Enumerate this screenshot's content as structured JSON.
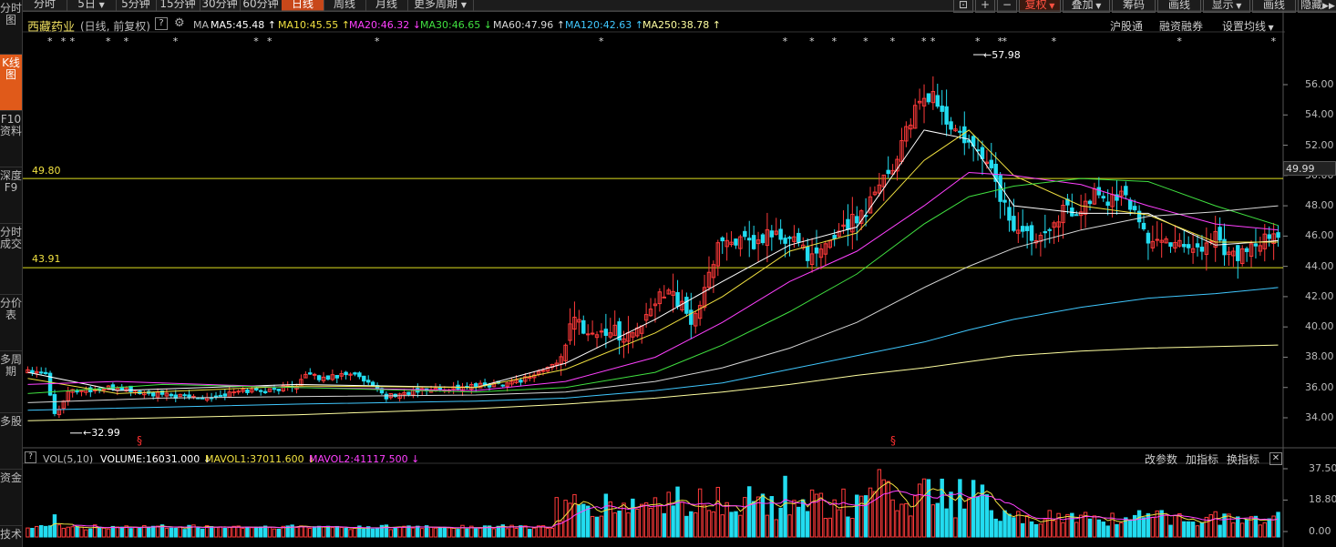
{
  "sidebar": [
    "分时图",
    "K线图",
    "F10资料",
    "深度F9",
    "分时成交",
    "分价表",
    "多周期",
    "多股",
    "资金",
    "技术"
  ],
  "toolbar": {
    "periods": [
      "分时",
      "5日",
      "5分钟",
      "15分钟",
      "30分钟",
      "60分钟",
      "日线",
      "周线",
      "月线",
      "更多周期"
    ],
    "right": [
      "复权",
      "叠加",
      "筹码",
      "画线",
      "显示",
      "画线",
      "隐藏"
    ]
  },
  "header": {
    "stock_name": "西藏药业",
    "mode": "(日线, 前复权)",
    "links": [
      "沪股通",
      "融资融券",
      "设置均线"
    ]
  },
  "ma": {
    "label": "MA",
    "lines": [
      {
        "text": "MA5:45.48 ↑",
        "color": "#ffffff"
      },
      {
        "text": "MA10:45.55 ↑",
        "color": "#f0e040"
      },
      {
        "text": "MA20:46.32 ↓",
        "color": "#ff40ff"
      },
      {
        "text": "MA30:46.65 ↓",
        "color": "#40e040"
      },
      {
        "text": "MA60:47.96 ↑",
        "color": "#d8d8d8"
      },
      {
        "text": "MA120:42.63 ↑",
        "color": "#40c8ff"
      },
      {
        "text": "MA250:38.78 ↑",
        "color": "#ffffa0"
      }
    ]
  },
  "chart_data": {
    "type": "candlestick",
    "y_ticks": [
      "56.00",
      "54.00",
      "52.00",
      "50.00",
      "48.00",
      "46.00",
      "44.00",
      "42.00",
      "40.00",
      "38.00",
      "36.00",
      "34.00"
    ],
    "ylim": [
      33,
      58.5
    ],
    "last_price": 49.99,
    "last_price_label": "49.99",
    "hlines": [
      {
        "value": 49.8,
        "label": "49.80",
        "color": "#e0e020"
      },
      {
        "value": 43.91,
        "label": "43.91",
        "color": "#e0e020"
      }
    ],
    "annotations": {
      "high": "←57.98",
      "low": "←32.99"
    },
    "colors": {
      "up": "#ff3a3a",
      "down": "#22dcf0"
    },
    "waypoints": [
      [
        0,
        37.2
      ],
      [
        4,
        37.0
      ],
      [
        6,
        34.2
      ],
      [
        9,
        35.8
      ],
      [
        14,
        35.8
      ],
      [
        20,
        36.0
      ],
      [
        26,
        35.6
      ],
      [
        34,
        35.4
      ],
      [
        42,
        35.4
      ],
      [
        48,
        35.8
      ],
      [
        54,
        35.8
      ],
      [
        60,
        36.2
      ],
      [
        62,
        36.8
      ],
      [
        66,
        36.6
      ],
      [
        72,
        37.0
      ],
      [
        76,
        36.2
      ],
      [
        80,
        35.4
      ],
      [
        88,
        35.8
      ],
      [
        96,
        36.0
      ],
      [
        104,
        36.2
      ],
      [
        110,
        36.5
      ],
      [
        114,
        37.0
      ],
      [
        118,
        37.6
      ],
      [
        122,
        40.5
      ],
      [
        126,
        39.5
      ],
      [
        130,
        39.8
      ],
      [
        134,
        39.4
      ],
      [
        138,
        40.4
      ],
      [
        140,
        41.6
      ],
      [
        143,
        42.8
      ],
      [
        146,
        41.2
      ],
      [
        148,
        40.4
      ],
      [
        151,
        42.2
      ],
      [
        154,
        45.6
      ],
      [
        158,
        45.8
      ],
      [
        162,
        45.2
      ],
      [
        166,
        46.3
      ],
      [
        169,
        45.5
      ],
      [
        172,
        45.8
      ],
      [
        175,
        44.4
      ],
      [
        178,
        45.2
      ],
      [
        181,
        46.5
      ],
      [
        184,
        47.0
      ],
      [
        187,
        47.8
      ],
      [
        190,
        49.8
      ],
      [
        193,
        50.4
      ],
      [
        196,
        53.2
      ],
      [
        199,
        54.6
      ],
      [
        202,
        55.4
      ],
      [
        205,
        53.4
      ],
      [
        208,
        52.6
      ],
      [
        211,
        51.6
      ],
      [
        214,
        51.2
      ],
      [
        217,
        48.6
      ],
      [
        220,
        46.6
      ],
      [
        223,
        46.0
      ],
      [
        226,
        46.2
      ],
      [
        229,
        47.2
      ],
      [
        232,
        47.8
      ],
      [
        235,
        47.6
      ],
      [
        238,
        48.8
      ],
      [
        241,
        48.4
      ],
      [
        244,
        48.6
      ],
      [
        247,
        47.8
      ],
      [
        250,
        45.8
      ],
      [
        253,
        45.5
      ],
      [
        256,
        45.8
      ],
      [
        259,
        45.4
      ],
      [
        262,
        45.2
      ],
      [
        265,
        46.2
      ],
      [
        268,
        44.8
      ],
      [
        271,
        44.8
      ],
      [
        274,
        45.2
      ],
      [
        277,
        45.9
      ],
      [
        279,
        45.8
      ]
    ],
    "ma_colors": [
      "#ffffff",
      "#f0e040",
      "#ff40ff",
      "#40e040",
      "#d8d8d8",
      "#40c8ff",
      "#ffffa0"
    ],
    "ma_lines": [
      [
        [
          0,
          37.0
        ],
        [
          20,
          35.8
        ],
        [
          60,
          36.2
        ],
        [
          100,
          36.0
        ],
        [
          120,
          37.6
        ],
        [
          140,
          40.5
        ],
        [
          155,
          43.0
        ],
        [
          170,
          45.4
        ],
        [
          185,
          46.6
        ],
        [
          200,
          53.0
        ],
        [
          210,
          52.4
        ],
        [
          220,
          48.0
        ],
        [
          235,
          47.5
        ],
        [
          250,
          47.5
        ],
        [
          265,
          45.4
        ],
        [
          279,
          45.7
        ]
      ],
      [
        [
          0,
          36.6
        ],
        [
          20,
          35.6
        ],
        [
          60,
          36.1
        ],
        [
          100,
          36.0
        ],
        [
          120,
          37.2
        ],
        [
          140,
          39.6
        ],
        [
          155,
          42.0
        ],
        [
          170,
          45.0
        ],
        [
          185,
          46.2
        ],
        [
          200,
          51.0
        ],
        [
          210,
          53.0
        ],
        [
          220,
          50.0
        ],
        [
          235,
          48.0
        ],
        [
          250,
          47.4
        ],
        [
          265,
          45.6
        ],
        [
          279,
          45.6
        ]
      ],
      [
        [
          0,
          36.2
        ],
        [
          20,
          36.4
        ],
        [
          60,
          36.0
        ],
        [
          100,
          35.8
        ],
        [
          120,
          36.4
        ],
        [
          140,
          38.0
        ],
        [
          155,
          40.3
        ],
        [
          170,
          43.0
        ],
        [
          185,
          45.0
        ],
        [
          200,
          48.0
        ],
        [
          210,
          50.2
        ],
        [
          220,
          50.0
        ],
        [
          235,
          49.4
        ],
        [
          250,
          48.0
        ],
        [
          265,
          46.8
        ],
        [
          279,
          46.4
        ]
      ],
      [
        [
          0,
          35.6
        ],
        [
          30,
          36.2
        ],
        [
          60,
          36.0
        ],
        [
          100,
          35.7
        ],
        [
          120,
          36.0
        ],
        [
          140,
          37.0
        ],
        [
          155,
          38.8
        ],
        [
          170,
          41.0
        ],
        [
          185,
          43.5
        ],
        [
          200,
          46.8
        ],
        [
          210,
          48.6
        ],
        [
          220,
          49.3
        ],
        [
          235,
          49.8
        ],
        [
          250,
          49.6
        ],
        [
          265,
          48.0
        ],
        [
          279,
          46.7
        ]
      ],
      [
        [
          0,
          35.0
        ],
        [
          30,
          35.3
        ],
        [
          60,
          35.4
        ],
        [
          100,
          35.5
        ],
        [
          120,
          35.7
        ],
        [
          140,
          36.4
        ],
        [
          155,
          37.3
        ],
        [
          170,
          38.6
        ],
        [
          185,
          40.3
        ],
        [
          200,
          42.6
        ],
        [
          210,
          44.0
        ],
        [
          220,
          45.2
        ],
        [
          235,
          46.4
        ],
        [
          250,
          47.3
        ],
        [
          265,
          47.6
        ],
        [
          279,
          48.0
        ]
      ],
      [
        [
          0,
          34.5
        ],
        [
          30,
          34.7
        ],
        [
          60,
          34.9
        ],
        [
          100,
          35.1
        ],
        [
          120,
          35.3
        ],
        [
          140,
          35.8
        ],
        [
          155,
          36.3
        ],
        [
          170,
          37.2
        ],
        [
          185,
          38.1
        ],
        [
          200,
          39.0
        ],
        [
          210,
          39.8
        ],
        [
          220,
          40.5
        ],
        [
          235,
          41.3
        ],
        [
          250,
          41.9
        ],
        [
          265,
          42.2
        ],
        [
          279,
          42.6
        ]
      ],
      [
        [
          0,
          33.8
        ],
        [
          30,
          34.0
        ],
        [
          60,
          34.2
        ],
        [
          100,
          34.6
        ],
        [
          120,
          34.9
        ],
        [
          140,
          35.3
        ],
        [
          155,
          35.7
        ],
        [
          170,
          36.2
        ],
        [
          185,
          36.8
        ],
        [
          200,
          37.3
        ],
        [
          210,
          37.7
        ],
        [
          220,
          38.1
        ],
        [
          235,
          38.4
        ],
        [
          250,
          38.6
        ],
        [
          265,
          38.7
        ],
        [
          279,
          38.8
        ]
      ]
    ]
  },
  "stars": {
    "text": "*",
    "days": [
      5,
      8,
      10,
      18,
      22,
      33,
      51,
      54,
      78,
      128,
      169,
      175,
      180,
      187,
      193,
      200,
      202,
      212,
      217,
      218,
      229,
      257,
      278
    ]
  },
  "volume": {
    "indicator": "VOL(5,10)",
    "volume_text": "VOLUME:16031.000 ↓",
    "mavol1_text": "MAVOL1:37011.600 ↓",
    "mavol2_text": "MAVOL2:41117.500 ↓",
    "links": [
      "改参数",
      "加指标",
      "换指标"
    ],
    "y_ticks": [
      "37.50",
      "18.80",
      "0.00"
    ],
    "ylim": [
      0,
      37.5
    ]
  }
}
